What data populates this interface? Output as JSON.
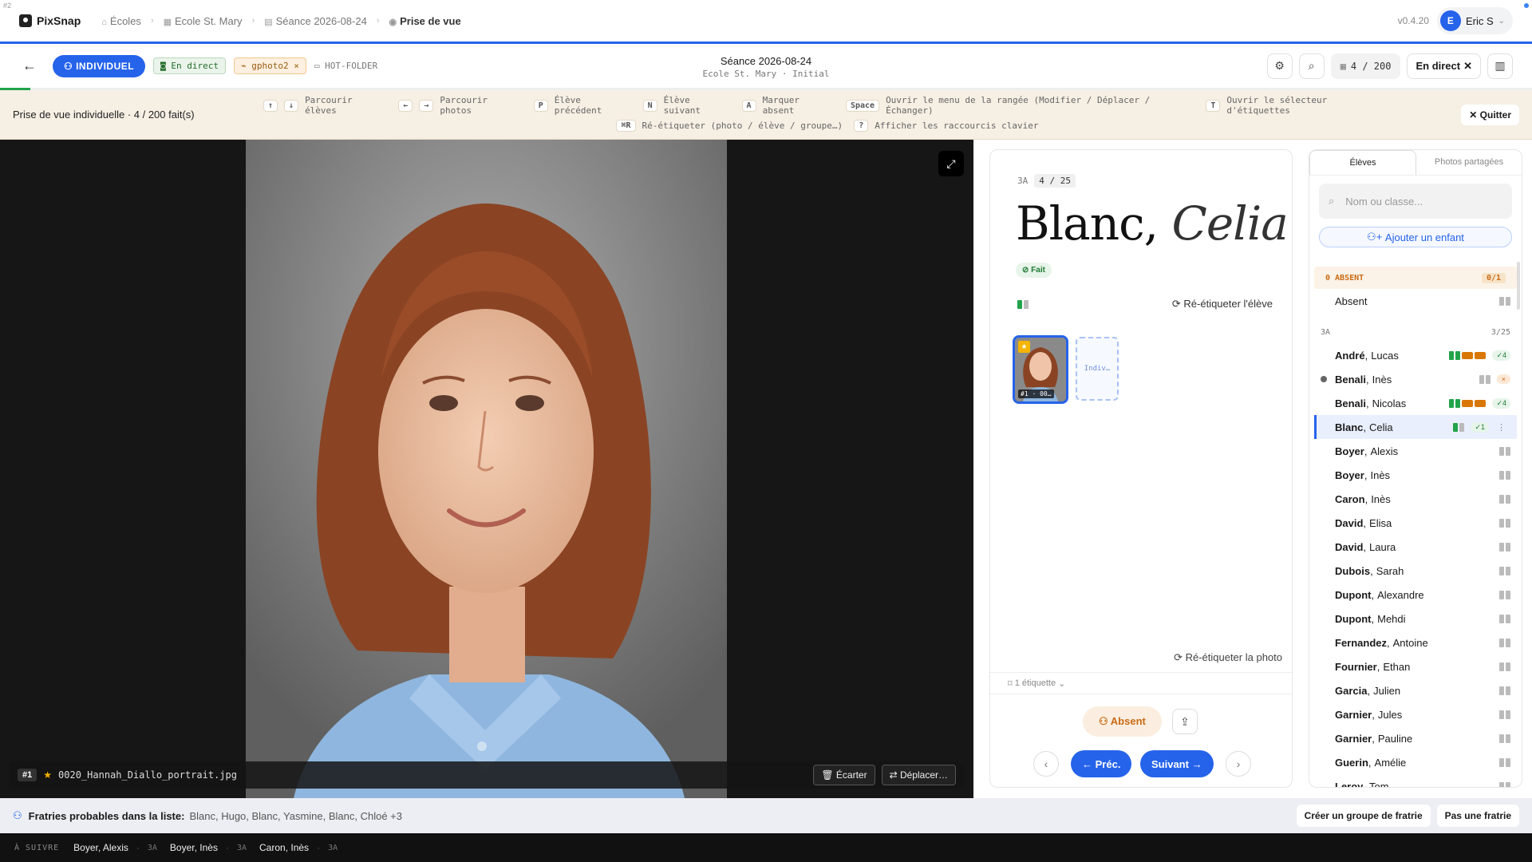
{
  "corner_label": "#2",
  "app": {
    "name": "PixSnap",
    "version": "v0.4.20"
  },
  "breadcrumb": [
    {
      "label": "Écoles",
      "icon": "school-icon"
    },
    {
      "label": "Ecole St. Mary",
      "icon": "building-icon"
    },
    {
      "label": "Séance 2026-08-24",
      "icon": "calendar-icon"
    },
    {
      "label": "Prise de vue",
      "icon": "camera-icon"
    }
  ],
  "user": {
    "initial": "E",
    "name": "Eric S"
  },
  "toolbar": {
    "mode_label": "INDIVIDUEL",
    "live_label": "En direct",
    "source_label": "gphoto2",
    "hotfolder_label": "HOT-FOLDER",
    "session_title": "Séance 2026-08-24",
    "session_sub": "Ecole St. Mary · Initial",
    "counter": "4 / 200",
    "live_button": "En direct"
  },
  "progress": {
    "done": 4,
    "total": 200
  },
  "shortcut_bar": {
    "title": "Prise de vue individuelle · 4 / 200 fait(s)",
    "row1": [
      {
        "keys": [
          "↑",
          "↓"
        ],
        "desc": "Parcourir élèves"
      },
      {
        "keys": [
          "←",
          "→"
        ],
        "desc": "Parcourir photos"
      },
      {
        "keys": [
          "P"
        ],
        "desc": "Élève précédent"
      },
      {
        "keys": [
          "N"
        ],
        "desc": "Élève suivant"
      },
      {
        "keys": [
          "A"
        ],
        "desc": "Marquer absent"
      },
      {
        "keys": [
          "Space"
        ],
        "desc": "Ouvrir le menu de la rangée (Modifier / Déplacer / Échanger)"
      },
      {
        "keys": [
          "T"
        ],
        "desc": "Ouvrir le sélecteur d'étiquettes"
      }
    ],
    "row2": [
      {
        "keys": [
          "⌘R"
        ],
        "desc": "Ré-étiqueter (photo / élève / groupe…)"
      },
      {
        "keys": [
          "?"
        ],
        "desc": "Afficher les raccourcis clavier"
      }
    ],
    "quit_label": "Quitter"
  },
  "viewer": {
    "photo_number": "#1",
    "filename": "0020_Hannah_Diallo_portrait.jpg",
    "discard_label": "Écarter",
    "move_label": "Déplacer…"
  },
  "student": {
    "class": "3A",
    "position": "4 / 25",
    "last_name": "Blanc",
    "first_name": "Celia",
    "status": "Fait",
    "retag_student_label": "Ré-étiqueter l'élève",
    "thumb_label": "#1 · 00…",
    "slot_label": "Indiv…",
    "retag_photo_label": "Ré-étiqueter la photo",
    "tags_label": "1 étiquette",
    "absent_label": "Absent",
    "prev_label": "Préc.",
    "next_label": "Suivant"
  },
  "roster": {
    "tabs": [
      "Élèves",
      "Photos partagées"
    ],
    "search_placeholder": "Nom ou classe...",
    "add_child_label": "Ajouter un enfant",
    "absent_group": {
      "label": "0 ABSENT",
      "count": "0/1",
      "item": "Absent"
    },
    "class_group": {
      "label": "3A",
      "count": "3/25"
    },
    "students": [
      {
        "last": "André",
        "first": "Lucas",
        "state": "done",
        "badge": "✓4"
      },
      {
        "last": "Benali",
        "first": "Inès",
        "state": "absent",
        "badge": "×"
      },
      {
        "last": "Benali",
        "first": "Nicolas",
        "state": "done",
        "badge": "✓4"
      },
      {
        "last": "Blanc",
        "first": "Celia",
        "state": "active",
        "badge": "✓1"
      },
      {
        "last": "Boyer",
        "first": "Alexis",
        "state": "todo",
        "badge": ""
      },
      {
        "last": "Boyer",
        "first": "Inès",
        "state": "todo",
        "badge": ""
      },
      {
        "last": "Caron",
        "first": "Inès",
        "state": "todo",
        "badge": ""
      },
      {
        "last": "David",
        "first": "Elisa",
        "state": "todo",
        "badge": ""
      },
      {
        "last": "David",
        "first": "Laura",
        "state": "todo",
        "badge": ""
      },
      {
        "last": "Dubois",
        "first": "Sarah",
        "state": "todo",
        "badge": ""
      },
      {
        "last": "Dupont",
        "first": "Alexandre",
        "state": "todo",
        "badge": ""
      },
      {
        "last": "Dupont",
        "first": "Mehdi",
        "state": "todo",
        "badge": ""
      },
      {
        "last": "Fernandez",
        "first": "Antoine",
        "state": "todo",
        "badge": ""
      },
      {
        "last": "Fournier",
        "first": "Ethan",
        "state": "todo",
        "badge": ""
      },
      {
        "last": "Garcia",
        "first": "Julien",
        "state": "todo",
        "badge": ""
      },
      {
        "last": "Garnier",
        "first": "Jules",
        "state": "todo",
        "badge": ""
      },
      {
        "last": "Garnier",
        "first": "Pauline",
        "state": "todo",
        "badge": ""
      },
      {
        "last": "Guerin",
        "first": "Amélie",
        "state": "todo",
        "badge": ""
      },
      {
        "last": "Leroy",
        "first": "Tom",
        "state": "todo",
        "badge": ""
      }
    ]
  },
  "siblings": {
    "label": "Fratries probables dans la liste:",
    "names": "Blanc, Hugo, Blanc, Yasmine, Blanc, Chloé +3",
    "create_label": "Créer un groupe de fratrie",
    "none_label": "Pas une fratrie"
  },
  "next_up": {
    "label": "À SUIVRE",
    "items": [
      {
        "name": "Boyer, Alexis",
        "class": "3A"
      },
      {
        "name": "Boyer, Inès",
        "class": "3A"
      },
      {
        "name": "Caron, Inès",
        "class": "3A"
      }
    ]
  },
  "colors": {
    "accent": "#2563eb",
    "done": "#22a34a",
    "warning": "#d97706",
    "absent_bg": "#fbeee0"
  }
}
